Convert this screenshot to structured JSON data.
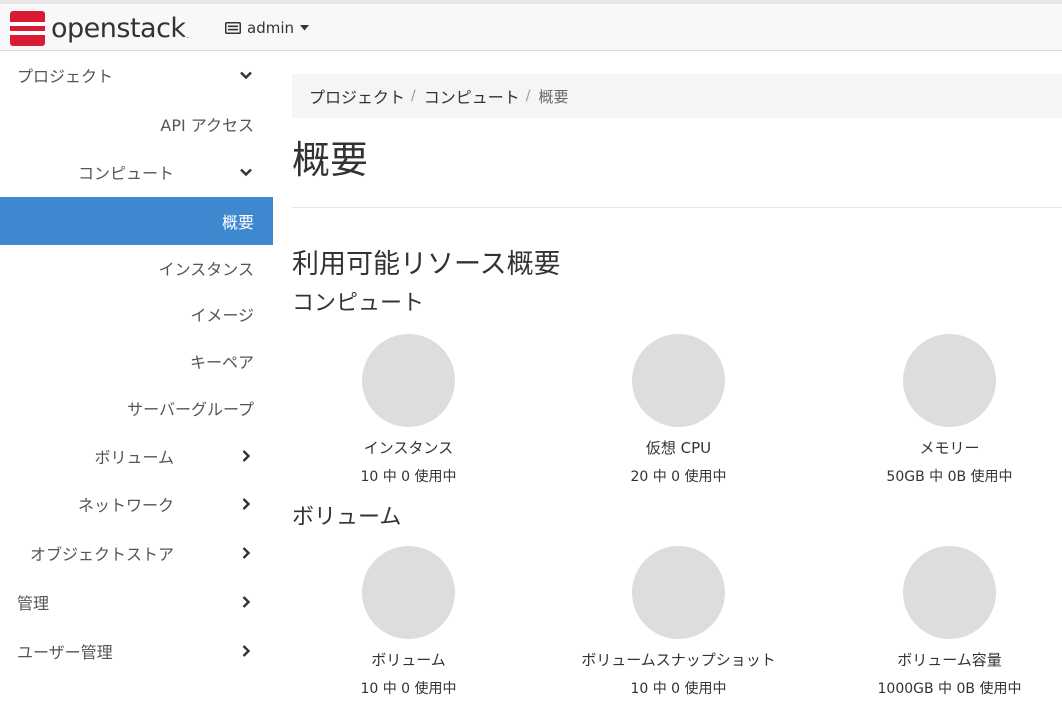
{
  "header": {
    "brand": "openstack",
    "brand_mark": ".",
    "project": "admin"
  },
  "sidebar": {
    "items": [
      {
        "label": "プロジェクト"
      },
      {
        "label": "API アクセス"
      },
      {
        "label": "コンピュート"
      },
      {
        "label": "概要"
      },
      {
        "label": "インスタンス"
      },
      {
        "label": "イメージ"
      },
      {
        "label": "キーペア"
      },
      {
        "label": "サーバーグループ"
      },
      {
        "label": "ボリューム"
      },
      {
        "label": "ネットワーク"
      },
      {
        "label": "オブジェクトストア"
      },
      {
        "label": "管理"
      },
      {
        "label": "ユーザー管理"
      }
    ]
  },
  "breadcrumb": {
    "items": [
      "プロジェクト",
      "コンピュート",
      "概要"
    ],
    "separator": "/"
  },
  "page": {
    "title": "概要",
    "section_title": "利用可能リソース概要"
  },
  "groups": {
    "compute": {
      "title": "コンピュート",
      "charts": [
        {
          "label": "インスタンス",
          "usage": "10 中 0 使用中"
        },
        {
          "label": "仮想 CPU",
          "usage": "20 中 0 使用中"
        },
        {
          "label": "メモリー",
          "usage": "50GB 中 0B 使用中"
        }
      ]
    },
    "volume": {
      "title": "ボリューム",
      "charts": [
        {
          "label": "ボリューム",
          "usage": "10 中 0 使用中"
        },
        {
          "label": "ボリュームスナップショット",
          "usage": "10 中 0 使用中"
        },
        {
          "label": "ボリューム容量",
          "usage": "1000GB 中 0B 使用中"
        }
      ]
    }
  },
  "colors": {
    "brand_red": "#da1a32",
    "active_blue": "#3e88d0",
    "chart_gray": "#dddddd"
  }
}
